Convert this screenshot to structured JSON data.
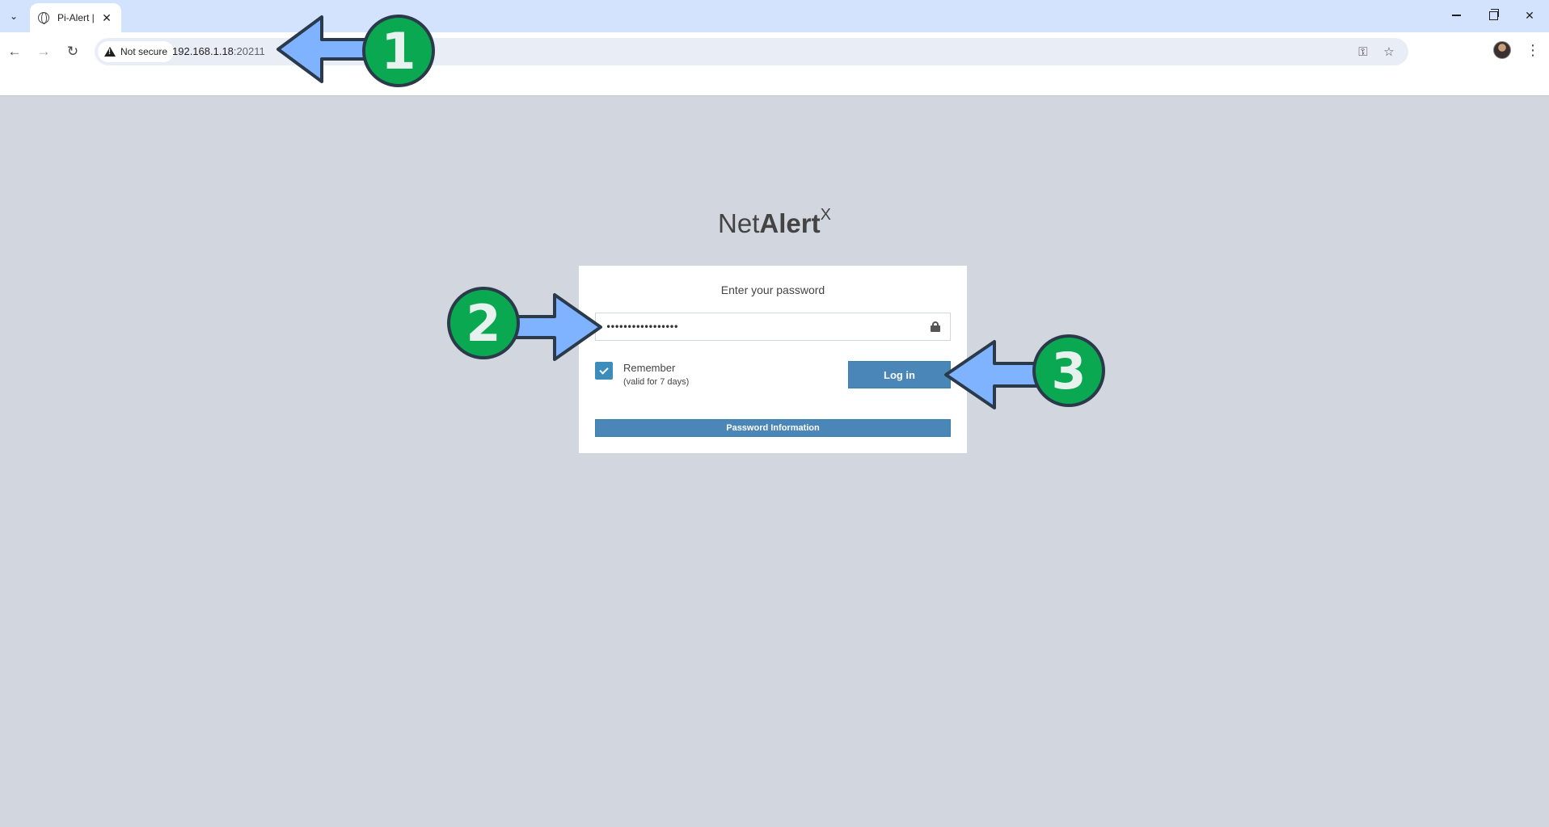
{
  "browser": {
    "tab_title": "Pi-Alert |",
    "security_label": "Not secure",
    "url_host": "192.168.1.18",
    "url_port": ":20211"
  },
  "login": {
    "logo_net": "Net",
    "logo_alert": "Alert",
    "logo_x": "X",
    "message": "Enter your password",
    "password_value": "•••••••••••••••••",
    "remember_label": "Remember",
    "remember_sub": "(valid for 7 days)",
    "remember_checked": true,
    "login_button": "Log in",
    "password_info_button": "Password Information"
  },
  "annotations": {
    "badges": [
      "1",
      "2",
      "3"
    ],
    "colors": {
      "badge": "#0ba852",
      "arrow": "#7fb2ff",
      "outline": "#2a3a4a"
    }
  },
  "colors": {
    "page_bg": "#d2d6de",
    "button_blue": "#4b86b8",
    "tabbar": "#d3e3fd"
  }
}
